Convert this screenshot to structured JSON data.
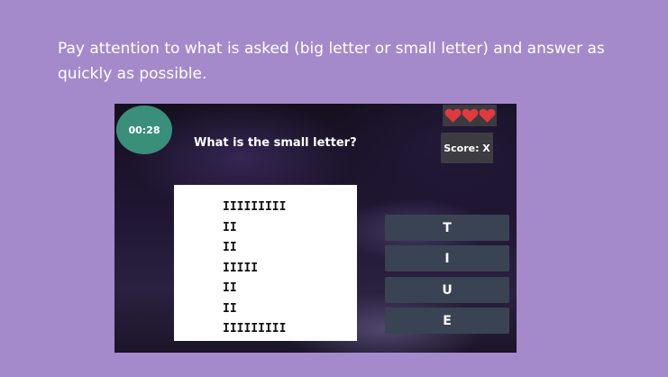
{
  "instructions": "Pay attention to what is asked (big letter or small letter) and answer as quickly as possible.",
  "game": {
    "timer": "00:28",
    "question": "What is the small letter?",
    "lives": [
      "heart-icon",
      "heart-icon",
      "heart-icon"
    ],
    "lives_color": "#e0393e",
    "score": "Score: X",
    "letter_art": "IIIIIIIII\nII\nII\nIIIII\nII\nII\nIIIIIIIII",
    "answers": [
      "T",
      "I",
      "U",
      "E"
    ]
  }
}
